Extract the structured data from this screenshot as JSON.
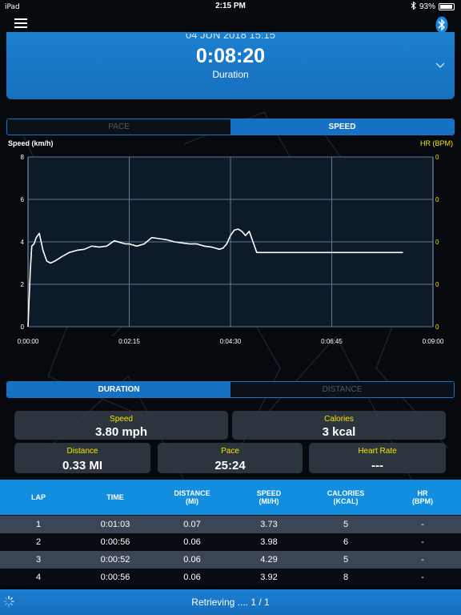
{
  "status_bar": {
    "time": "2:15 PM",
    "battery": "93%",
    "battery_level": 0.93
  },
  "summary": {
    "date": "04 JUN 2018 15:15",
    "value": "0:08:20",
    "label": "Duration"
  },
  "metric_tabs": {
    "pace": "PACE",
    "speed": "SPEED",
    "active": "speed"
  },
  "chart_data": {
    "type": "line",
    "left_axis_label": "Speed (km/h)",
    "right_axis_label": "HR (BPM)",
    "x_ticks": [
      "0:00:00",
      "0:02:15",
      "0:04:30",
      "0:06:45",
      "0:09:00"
    ],
    "y_ticks_left": [
      "0",
      "2",
      "4",
      "6",
      "8"
    ],
    "y_ticks_right": [
      "0",
      "0",
      "0",
      "0",
      "0"
    ],
    "ylim": [
      0,
      8
    ],
    "xlim_seconds": [
      0,
      540
    ],
    "grid": true,
    "series": [
      {
        "color": "#ffffff",
        "x_seconds": [
          0,
          3,
          5,
          8,
          11,
          15,
          20,
          25,
          30,
          36,
          45,
          55,
          65,
          75,
          85,
          95,
          105,
          115,
          125,
          130,
          135,
          145,
          155,
          165,
          175,
          185,
          195,
          205,
          215,
          225,
          235,
          245,
          250,
          255,
          260,
          265,
          270,
          275,
          280,
          285,
          290,
          295,
          300,
          305,
          310,
          315,
          500
        ],
        "y": [
          0,
          2.6,
          3.8,
          3.9,
          4.2,
          4.4,
          3.6,
          3.1,
          3.0,
          3.1,
          3.3,
          3.5,
          3.6,
          3.65,
          3.8,
          3.75,
          3.8,
          4.05,
          3.95,
          3.9,
          3.9,
          3.8,
          3.9,
          4.2,
          4.15,
          4.1,
          4.0,
          3.95,
          3.9,
          3.9,
          3.8,
          3.75,
          3.7,
          3.65,
          3.7,
          3.9,
          4.3,
          4.55,
          4.6,
          4.5,
          4.3,
          4.5,
          4.0,
          3.5,
          3.5,
          3.5,
          3.5
        ]
      }
    ]
  },
  "view_tabs": {
    "duration": "DURATION",
    "distance": "DISTANCE",
    "active": "duration"
  },
  "stats": {
    "speed": {
      "label": "Speed",
      "value": "3.80 mph"
    },
    "calories": {
      "label": "Calories",
      "value": "3 kcal"
    },
    "distance": {
      "label": "Distance",
      "value": "0.33 MI"
    },
    "pace": {
      "label": "Pace",
      "value": "25:24"
    },
    "heart_rate": {
      "label": "Heart Rate",
      "value": "---"
    }
  },
  "laps": {
    "headers": {
      "lap": "LAP",
      "time": "TIME",
      "distance": "DISTANCE\n(MI)",
      "speed": "SPEED\n(MI/H)",
      "calories": "CALORIES\n(KCAL)",
      "hr": "HR\n(BPM)"
    },
    "rows": [
      {
        "lap": "1",
        "time": "0:01:03",
        "distance": "0.07",
        "speed": "3.73",
        "calories": "5",
        "hr": "-"
      },
      {
        "lap": "2",
        "time": "0:00:56",
        "distance": "0.06",
        "speed": "3.98",
        "calories": "6",
        "hr": "-"
      },
      {
        "lap": "3",
        "time": "0:00:52",
        "distance": "0.06",
        "speed": "4.29",
        "calories": "5",
        "hr": "-"
      },
      {
        "lap": "4",
        "time": "0:00:56",
        "distance": "0.06",
        "speed": "3.92",
        "calories": "8",
        "hr": "-"
      }
    ]
  },
  "footer": {
    "status": "Retrieving .... 1 / 1"
  },
  "colors": {
    "accent": "#1670c4",
    "stat_label": "#f2e600",
    "table_header": "#118ee0",
    "row_alt": "#3c4555"
  }
}
